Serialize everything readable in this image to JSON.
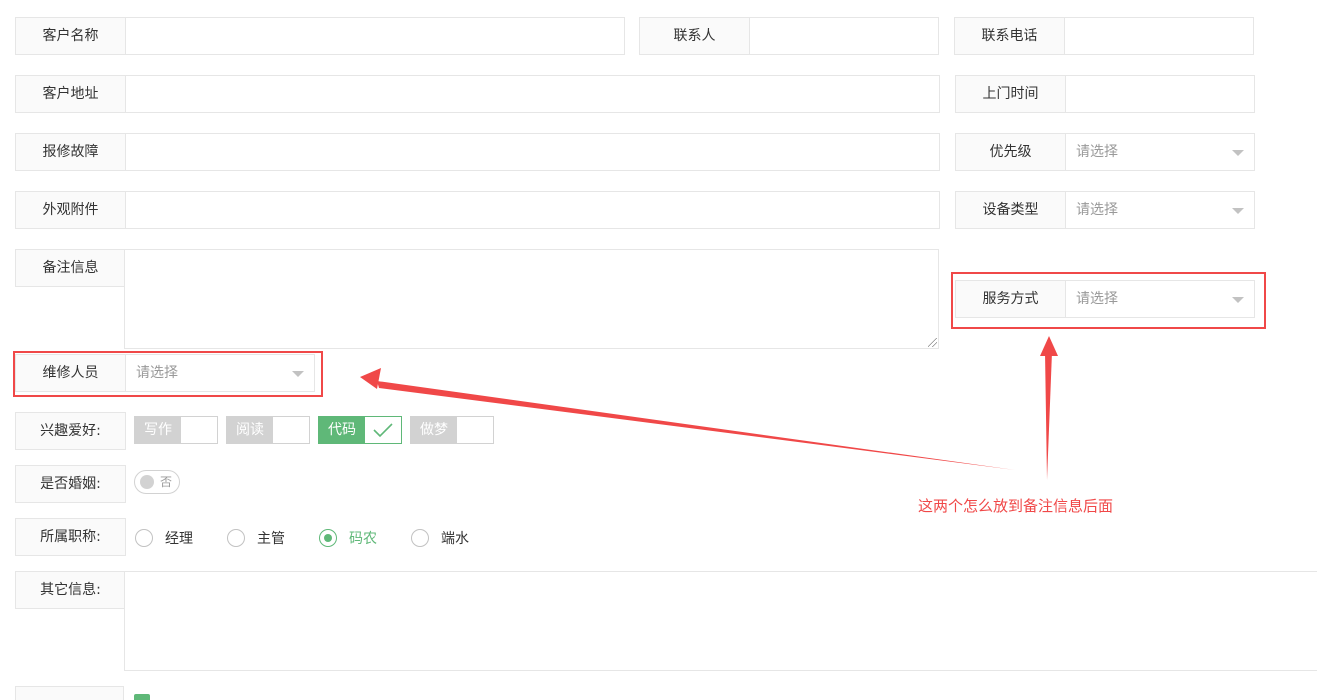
{
  "form": {
    "customer_name": {
      "label": "客户名称",
      "value": ""
    },
    "contact": {
      "label": "联系人",
      "value": ""
    },
    "phone": {
      "label": "联系电话",
      "value": ""
    },
    "address": {
      "label": "客户地址",
      "value": ""
    },
    "visit_time": {
      "label": "上门时间",
      "value": ""
    },
    "fault": {
      "label": "报修故障",
      "value": ""
    },
    "priority": {
      "label": "优先级",
      "value": "请选择"
    },
    "appearance": {
      "label": "外观附件",
      "value": ""
    },
    "device_type": {
      "label": "设备类型",
      "value": "请选择"
    },
    "remark": {
      "label": "备注信息",
      "value": ""
    },
    "service_mode": {
      "label": "服务方式",
      "value": "请选择"
    },
    "repair_staff": {
      "label": "维修人员",
      "value": "请选择"
    },
    "hobbies": {
      "label": "兴趣爱好:",
      "options": [
        {
          "text": "写作",
          "checked": false
        },
        {
          "text": "阅读",
          "checked": false
        },
        {
          "text": "代码",
          "checked": true
        },
        {
          "text": "做梦",
          "checked": false
        }
      ]
    },
    "married": {
      "label": "是否婚姻:",
      "switch_text": "否",
      "on": false
    },
    "title": {
      "label": "所属职称:",
      "options": [
        {
          "text": "经理",
          "checked": false
        },
        {
          "text": "主管",
          "checked": false
        },
        {
          "text": "码农",
          "checked": true
        },
        {
          "text": "端水",
          "checked": false
        }
      ]
    },
    "other_info": {
      "label": "其它信息:",
      "value": ""
    }
  },
  "annotation": {
    "note": "这两个怎么放到备注信息后面",
    "color": "#f04848"
  },
  "colors": {
    "accent": "#5fb878",
    "border": "#e6e6e6",
    "label_bg": "#fafafa"
  },
  "icons": {
    "checked": "check-icon",
    "select": "chevron-down-icon"
  }
}
